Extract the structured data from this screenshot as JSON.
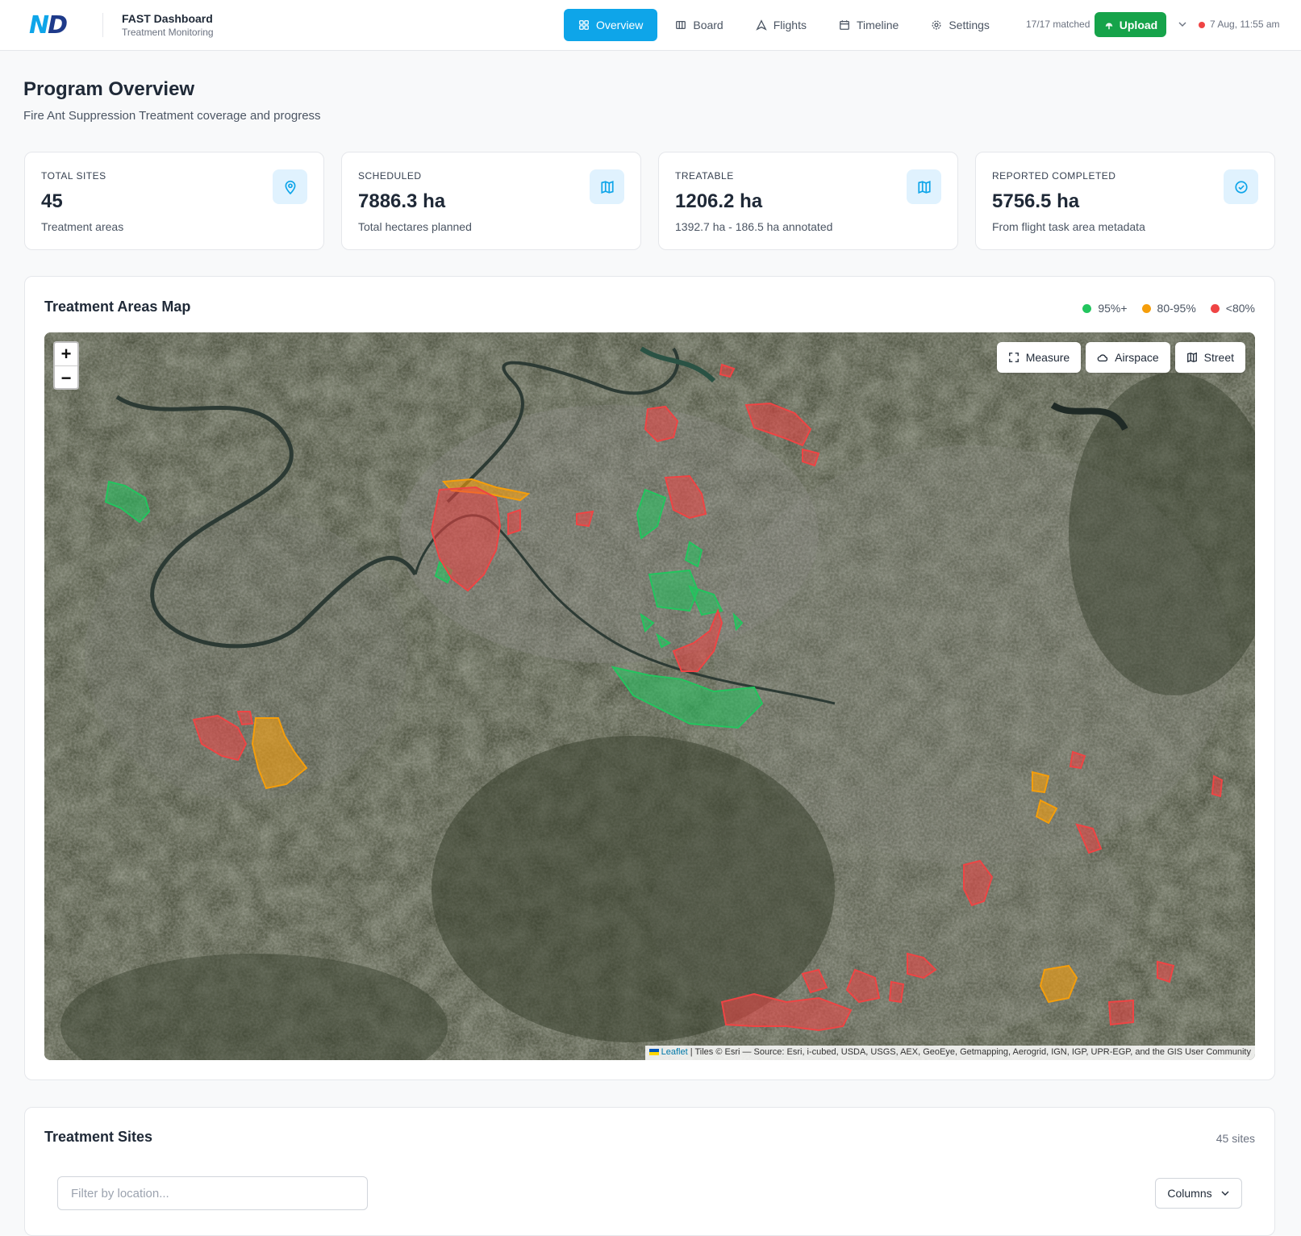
{
  "header": {
    "logo": "ND",
    "app_title": "FAST Dashboard",
    "app_subtitle": "Treatment Monitoring",
    "nav": [
      {
        "label": "Overview",
        "icon": "grid-icon",
        "active": true
      },
      {
        "label": "Board",
        "icon": "board-icon"
      },
      {
        "label": "Flights",
        "icon": "flight-icon"
      },
      {
        "label": "Timeline",
        "icon": "calendar-icon"
      },
      {
        "label": "Settings",
        "icon": "gear-icon"
      }
    ],
    "matched": "17/17 matched",
    "upload_label": "Upload",
    "status_time": "7 Aug, 11:55 am",
    "status_color": "#ef4444"
  },
  "page": {
    "title": "Program Overview",
    "subtitle": "Fire Ant Suppression Treatment coverage and progress"
  },
  "stats": [
    {
      "label": "TOTAL SITES",
      "value": "45",
      "desc": "Treatment areas",
      "icon": "pin-icon"
    },
    {
      "label": "SCHEDULED",
      "value": "7886.3 ha",
      "desc": "Total hectares planned",
      "icon": "map-icon"
    },
    {
      "label": "TREATABLE",
      "value": "1206.2 ha",
      "desc": "1392.7 ha - 186.5 ha annotated",
      "icon": "map-icon"
    },
    {
      "label": "REPORTED COMPLETED",
      "value": "5756.5 ha",
      "desc": "From flight task area metadata",
      "icon": "check-circle-icon"
    }
  ],
  "map": {
    "title": "Treatment Areas Map",
    "legend": [
      {
        "label": "95%+",
        "color": "#22c55e"
      },
      {
        "label": "80-95%",
        "color": "#f59e0b"
      },
      {
        "label": "<80%",
        "color": "#ef4444"
      }
    ],
    "zoom_in": "+",
    "zoom_out": "−",
    "tools": [
      {
        "label": "Measure",
        "icon": "measure-icon"
      },
      {
        "label": "Airspace",
        "icon": "cloud-icon"
      },
      {
        "label": "Street",
        "icon": "map-icon"
      }
    ],
    "attribution_link": "Leaflet",
    "attribution_text": " | Tiles © Esri — Source: Esri, i-cubed, USDA, USGS, AEX, GeoEye, Getmapping, Aerogrid, IGN, IGP, UPR-EGP, and the GIS User Community"
  },
  "sites": {
    "title": "Treatment Sites",
    "count": "45 sites",
    "filter_placeholder": "Filter by location...",
    "columns_label": "Columns"
  }
}
